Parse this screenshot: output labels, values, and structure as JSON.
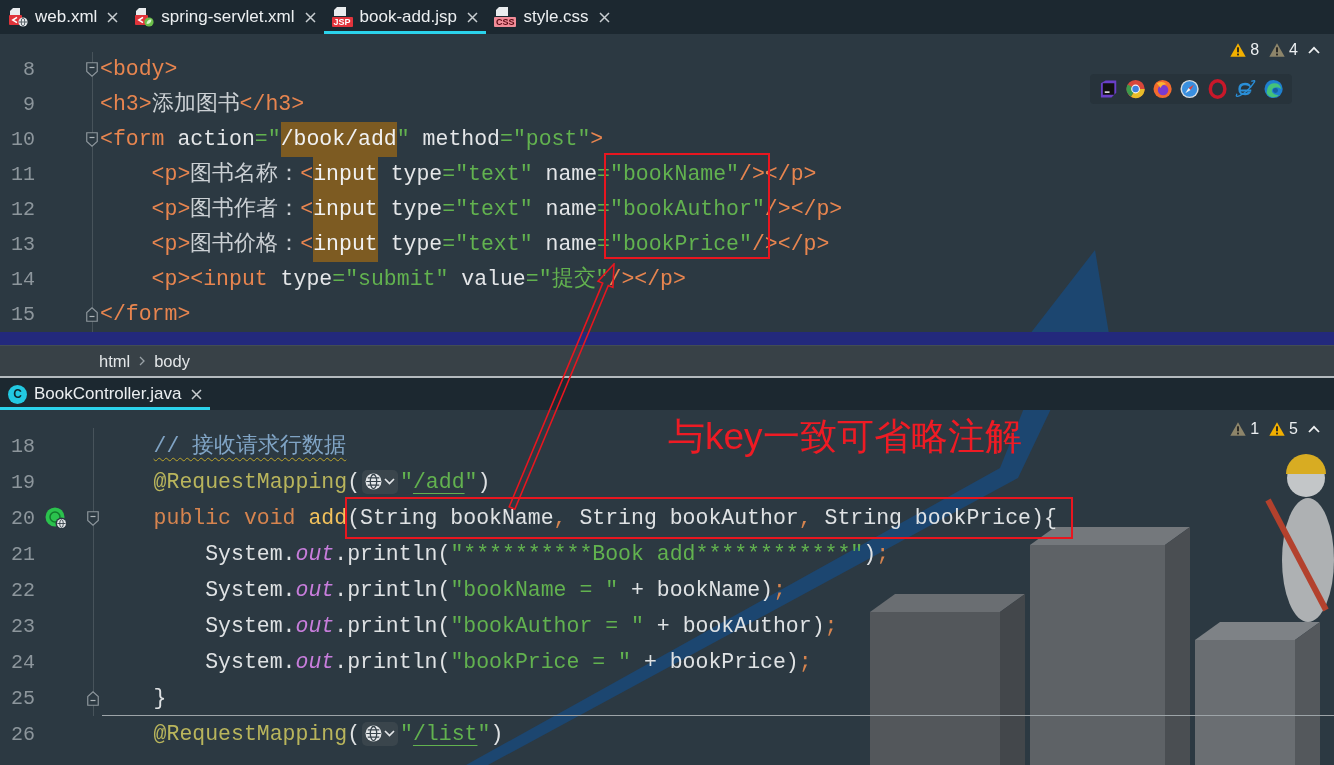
{
  "top_editor": {
    "tabs": [
      {
        "label": "web.xml",
        "kind": "xml",
        "selected": false
      },
      {
        "label": "spring-servlet.xml",
        "kind": "spring",
        "selected": false
      },
      {
        "label": "book-add.jsp",
        "kind": "jsp",
        "badge": "JSP",
        "selected": true
      },
      {
        "label": "style.css",
        "kind": "css",
        "badge": "CSS",
        "selected": false
      }
    ],
    "inspections": [
      {
        "kind": "warning",
        "count": "8"
      },
      {
        "kind": "weak_warning",
        "count": "4"
      }
    ],
    "lines": [
      {
        "number": "8",
        "kind": "fold-start",
        "tokens": [
          {
            "kind": "tag",
            "text": "<body>"
          }
        ]
      },
      {
        "number": "9",
        "kind": "plain",
        "tokens": [
          {
            "kind": "tag",
            "text": "<h3>"
          },
          {
            "kind": "text",
            "text": "添加图书"
          },
          {
            "kind": "tag",
            "text": "</h3>"
          }
        ]
      },
      {
        "number": "10",
        "kind": "fold-start",
        "tokens": [
          {
            "kind": "tag",
            "text": "<form"
          },
          {
            "kind": "attr",
            "text": " action"
          },
          {
            "kind": "str",
            "text": "=\""
          },
          {
            "kind": "usage",
            "text": "/book/add"
          },
          {
            "kind": "str",
            "text": "\""
          },
          {
            "kind": "attr",
            "text": " method"
          },
          {
            "kind": "str",
            "text": "=\"post\""
          },
          {
            "kind": "tag",
            "text": ">"
          }
        ]
      },
      {
        "number": "11",
        "kind": "plain",
        "tokens": [
          {
            "kind": "tag",
            "text": "    <p>"
          },
          {
            "kind": "text",
            "text": "图书名称："
          },
          {
            "kind": "tag",
            "text": "<"
          },
          {
            "kind": "usage",
            "text": "input"
          },
          {
            "kind": "attr",
            "text": " type"
          },
          {
            "kind": "str",
            "text": "=\"text\""
          },
          {
            "kind": "attr",
            "text": " name"
          },
          {
            "kind": "str",
            "text": "=\"bookName\""
          },
          {
            "kind": "tag",
            "text": "/></p>"
          }
        ]
      },
      {
        "number": "12",
        "kind": "plain",
        "tokens": [
          {
            "kind": "tag",
            "text": "    <p>"
          },
          {
            "kind": "text",
            "text": "图书作者："
          },
          {
            "kind": "tag",
            "text": "<"
          },
          {
            "kind": "usage",
            "text": "input"
          },
          {
            "kind": "attr",
            "text": " type"
          },
          {
            "kind": "str",
            "text": "=\"text\""
          },
          {
            "kind": "attr",
            "text": " name"
          },
          {
            "kind": "str",
            "text": "=\"bookAuthor\""
          },
          {
            "kind": "tag",
            "text": "/></p>"
          }
        ]
      },
      {
        "number": "13",
        "kind": "plain",
        "tokens": [
          {
            "kind": "tag",
            "text": "    <p>"
          },
          {
            "kind": "text",
            "text": "图书价格："
          },
          {
            "kind": "tag",
            "text": "<"
          },
          {
            "kind": "usage",
            "text": "input"
          },
          {
            "kind": "attr",
            "text": " type"
          },
          {
            "kind": "str",
            "text": "=\"text\""
          },
          {
            "kind": "attr",
            "text": " name"
          },
          {
            "kind": "str",
            "text": "=\"bookPrice\""
          },
          {
            "kind": "tag",
            "text": "/></p>"
          }
        ]
      },
      {
        "number": "14",
        "kind": "plain",
        "tokens": [
          {
            "kind": "tag",
            "text": "    <p><input"
          },
          {
            "kind": "attr",
            "text": " type"
          },
          {
            "kind": "str",
            "text": "=\"submit\""
          },
          {
            "kind": "attr",
            "text": " value"
          },
          {
            "kind": "str",
            "text": "=\"提交\""
          },
          {
            "kind": "tag",
            "text": "/></p>"
          }
        ]
      },
      {
        "number": "15",
        "kind": "fold-end",
        "tokens": [
          {
            "kind": "tag",
            "text": "</form>"
          }
        ]
      }
    ],
    "current_line_highlight": true,
    "breadcrumbs": [
      "html",
      "body"
    ]
  },
  "bottom_editor": {
    "tabs": [
      {
        "label": "BookController.java",
        "kind": "class",
        "badge": "C",
        "selected": true
      }
    ],
    "inspections": [
      {
        "kind": "weak_warning",
        "count": "1"
      },
      {
        "kind": "warning",
        "count": "5"
      }
    ],
    "lines": [
      {
        "number": "18",
        "kind": "plain",
        "tokens": [
          {
            "kind": "comment",
            "text": "    // 接收请求行数据"
          }
        ]
      },
      {
        "number": "19",
        "kind": "plain",
        "tokens": [
          {
            "kind": "annotation",
            "text": "    @RequestMapping"
          },
          {
            "kind": "plain",
            "text": "("
          },
          {
            "kind": "inlay"
          },
          {
            "kind": "str",
            "text": "\""
          },
          {
            "kind": "link",
            "text": "/add"
          },
          {
            "kind": "str",
            "text": "\""
          },
          {
            "kind": "plain",
            "text": ")"
          }
        ]
      },
      {
        "number": "20",
        "kind": "method-start",
        "tokens": [
          {
            "kind": "keyword",
            "text": "    public void "
          },
          {
            "kind": "method",
            "text": "add"
          },
          {
            "kind": "boxed",
            "tokens": [
              {
                "kind": "plain",
                "text": "(String bookName"
              },
              {
                "kind": "punct",
                "text": ","
              },
              {
                "kind": "plain",
                "text": " String bookAuthor"
              },
              {
                "kind": "punct",
                "text": ","
              },
              {
                "kind": "plain",
                "text": " String bookPrice){"
              }
            ]
          }
        ]
      },
      {
        "number": "21",
        "kind": "plain",
        "tokens": [
          {
            "kind": "plain",
            "text": "        System."
          },
          {
            "kind": "field",
            "text": "out"
          },
          {
            "kind": "plain",
            "text": ".println("
          },
          {
            "kind": "str",
            "text": "\"**********Book add************\""
          },
          {
            "kind": "plain",
            "text": ")"
          },
          {
            "kind": "punct",
            "text": ";"
          }
        ]
      },
      {
        "number": "22",
        "kind": "plain",
        "tokens": [
          {
            "kind": "plain",
            "text": "        System."
          },
          {
            "kind": "field",
            "text": "out"
          },
          {
            "kind": "plain",
            "text": ".println("
          },
          {
            "kind": "str",
            "text": "\"bookName = \""
          },
          {
            "kind": "plain",
            "text": " + bookName)"
          },
          {
            "kind": "punct",
            "text": ";"
          }
        ]
      },
      {
        "number": "23",
        "kind": "plain",
        "tokens": [
          {
            "kind": "plain",
            "text": "        System."
          },
          {
            "kind": "field",
            "text": "out"
          },
          {
            "kind": "plain",
            "text": ".println("
          },
          {
            "kind": "str",
            "text": "\"bookAuthor = \""
          },
          {
            "kind": "plain",
            "text": " + bookAuthor)"
          },
          {
            "kind": "punct",
            "text": ";"
          }
        ]
      },
      {
        "number": "24",
        "kind": "plain",
        "tokens": [
          {
            "kind": "plain",
            "text": "        System."
          },
          {
            "kind": "field",
            "text": "out"
          },
          {
            "kind": "plain",
            "text": ".println("
          },
          {
            "kind": "str",
            "text": "\"bookPrice = \""
          },
          {
            "kind": "plain",
            "text": " + bookPrice)"
          },
          {
            "kind": "punct",
            "text": ";"
          }
        ]
      },
      {
        "number": "25",
        "kind": "method-end",
        "tokens": [
          {
            "kind": "plain",
            "text": "    }"
          }
        ]
      },
      {
        "number": "26",
        "kind": "plain",
        "tokens": [
          {
            "kind": "annotation",
            "text": "    @RequestMapping"
          },
          {
            "kind": "plain",
            "text": "("
          },
          {
            "kind": "inlay"
          },
          {
            "kind": "str",
            "text": "\""
          },
          {
            "kind": "link",
            "text": "/list"
          },
          {
            "kind": "str",
            "text": "\""
          },
          {
            "kind": "plain",
            "text": ")"
          }
        ]
      }
    ]
  },
  "annotation": {
    "note": "与key一致可省略注解"
  }
}
